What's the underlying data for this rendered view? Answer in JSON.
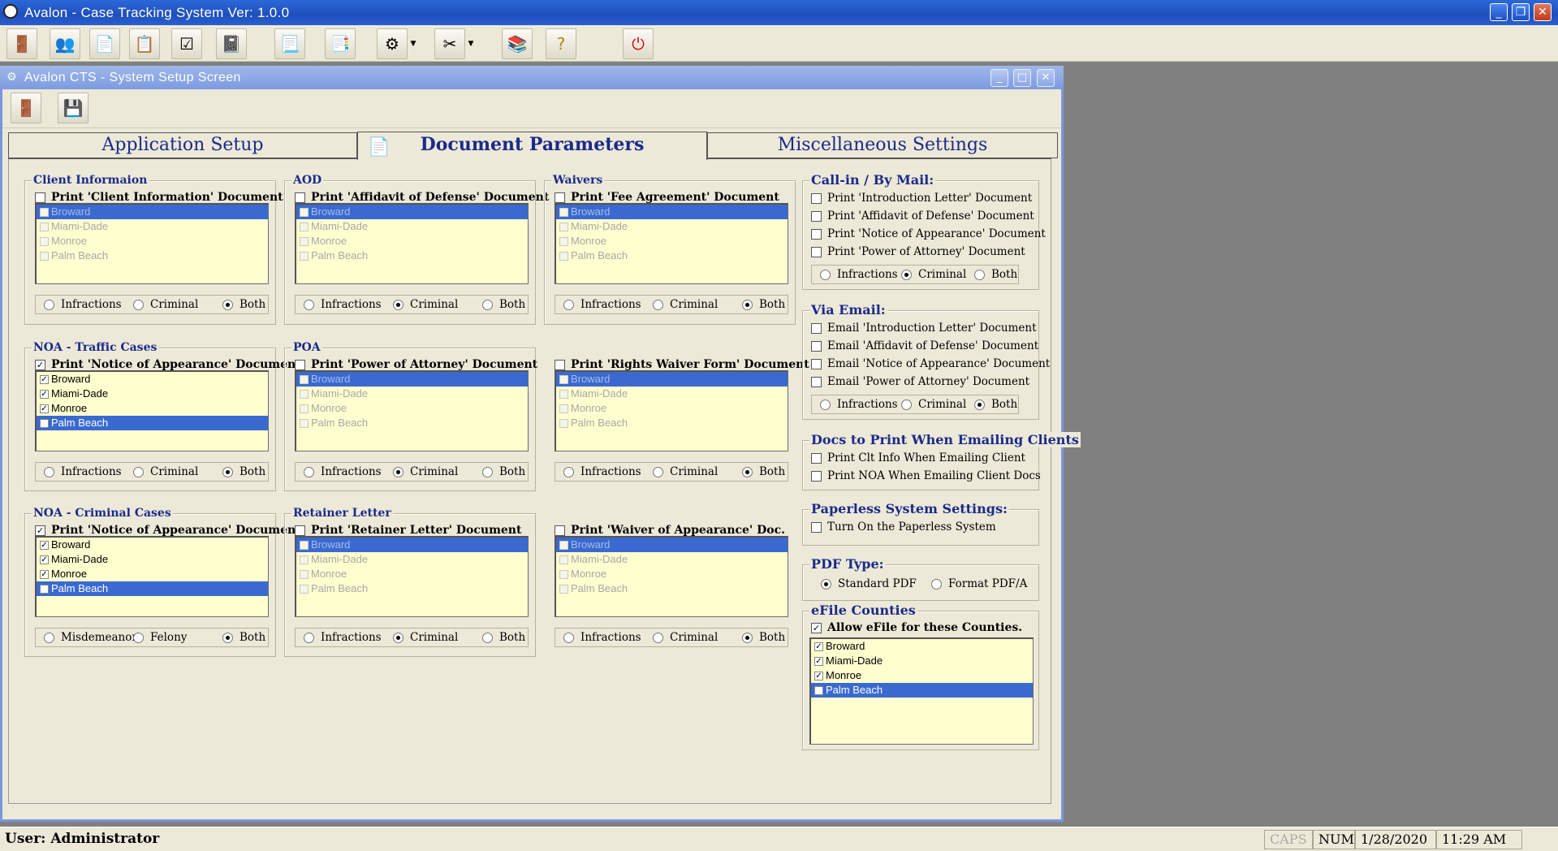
{
  "app": {
    "title": "Avalon - Case Tracking System   Ver: 1.0.0"
  },
  "child": {
    "title": "Avalon CTS - System Setup Screen"
  },
  "toolbar": {
    "icons": [
      "exit-door-icon",
      "users-icon",
      "document-icon",
      "clipboard-icon",
      "checklist-icon",
      "notepad-icon",
      "report-icon",
      "pages-icon",
      "settings-gear-icon",
      "tools-icon",
      "stacked-books-icon",
      "help-icon",
      "power-icon"
    ]
  },
  "tabs": [
    {
      "label": "Application Setup"
    },
    {
      "label": "Document Parameters"
    },
    {
      "label": "Miscellaneous Settings"
    }
  ],
  "counties": [
    "Broward",
    "Miami-Dade",
    "Monroe",
    "Palm Beach"
  ],
  "groups": {
    "client_info": {
      "legend": "Client Informaion",
      "check_label": "Print 'Client Information' Document",
      "checked": false,
      "radios": [
        "Infractions",
        "Criminal",
        "Both"
      ],
      "selected": "Both"
    },
    "aod": {
      "legend": "AOD",
      "check_label": "Print 'Affidavit of Defense' Document",
      "checked": false,
      "radios": [
        "Infractions",
        "Criminal",
        "Both"
      ],
      "selected": "Criminal"
    },
    "waivers": {
      "legend": "Waivers",
      "check_label": "Print 'Fee Agreement' Document",
      "checked": false,
      "radios": [
        "Infractions",
        "Criminal",
        "Both"
      ],
      "selected": "Both"
    },
    "noa_traffic": {
      "legend": "NOA - Traffic Cases",
      "check_label": "Print 'Notice of Appearance' Document",
      "checked": true,
      "radios": [
        "Infractions",
        "Criminal",
        "Both"
      ],
      "selected": "Both"
    },
    "poa": {
      "legend": "POA",
      "check_label": "Print 'Power of Attorney' Document",
      "checked": false,
      "radios": [
        "Infractions",
        "Criminal",
        "Both"
      ],
      "selected": "Criminal"
    },
    "rights_waiver": {
      "check_label": "Print 'Rights Waiver Form' Document",
      "checked": false,
      "radios": [
        "Infractions",
        "Criminal",
        "Both"
      ],
      "selected": "Both"
    },
    "noa_criminal": {
      "legend": "NOA - Criminal Cases",
      "check_label": "Print 'Notice of Appearance' Document",
      "checked": true,
      "radios": [
        "Misdemeanor",
        "Felony",
        "Both"
      ],
      "selected": "Both"
    },
    "retainer": {
      "legend": "Retainer Letter",
      "check_label": "Print 'Retainer Letter' Document",
      "checked": false,
      "radios": [
        "Infractions",
        "Criminal",
        "Both"
      ],
      "selected": "Criminal"
    },
    "waiver_appearance": {
      "check_label": "Print 'Waiver of Appearance' Doc.",
      "checked": false,
      "radios": [
        "Infractions",
        "Criminal",
        "Both"
      ],
      "selected": "Both"
    }
  },
  "right": {
    "callin": {
      "legend": "Call-in / By Mail:",
      "items": [
        "Print 'Introduction Letter' Document",
        "Print 'Affidavit of Defense' Document",
        "Print 'Notice of Appearance' Document",
        "Print 'Power of Attorney' Document"
      ],
      "radios": [
        "Infractions",
        "Criminal",
        "Both"
      ],
      "selected": "Criminal"
    },
    "email": {
      "legend": "Via Email:",
      "items": [
        "Email 'Introduction Letter' Document",
        "Email 'Affidavit of Defense' Document",
        "Email 'Notice of Appearance' Document",
        "Email 'Power of Attorney' Document"
      ],
      "radios": [
        "Infractions",
        "Criminal",
        "Both"
      ],
      "selected": "Both"
    },
    "docs_emailing": {
      "legend": "Docs to Print When Emailing Clients",
      "items": [
        "Print Clt Info When Emailing Client",
        "Print NOA When Emailing Client Docs"
      ]
    },
    "paperless": {
      "legend": "Paperless System Settings:",
      "item": "Turn On the Paperless System"
    },
    "pdf": {
      "legend": "PDF Type:",
      "options": [
        "Standard PDF",
        "Format PDF/A"
      ],
      "selected": "Standard PDF"
    },
    "efile": {
      "legend": "eFile Counties",
      "check_label": "Allow eFile for these Counties.",
      "checked": true
    }
  },
  "status": {
    "user": "User: Administrator",
    "caps": "CAPS",
    "num": "NUM",
    "date": "1/28/2020",
    "time": "11:29 AM"
  },
  "colors": {
    "selection": "#3a6ad0",
    "list_bg": "#fefecf",
    "legend": "#1b2a8a",
    "title_bar": "#2b68d8"
  }
}
